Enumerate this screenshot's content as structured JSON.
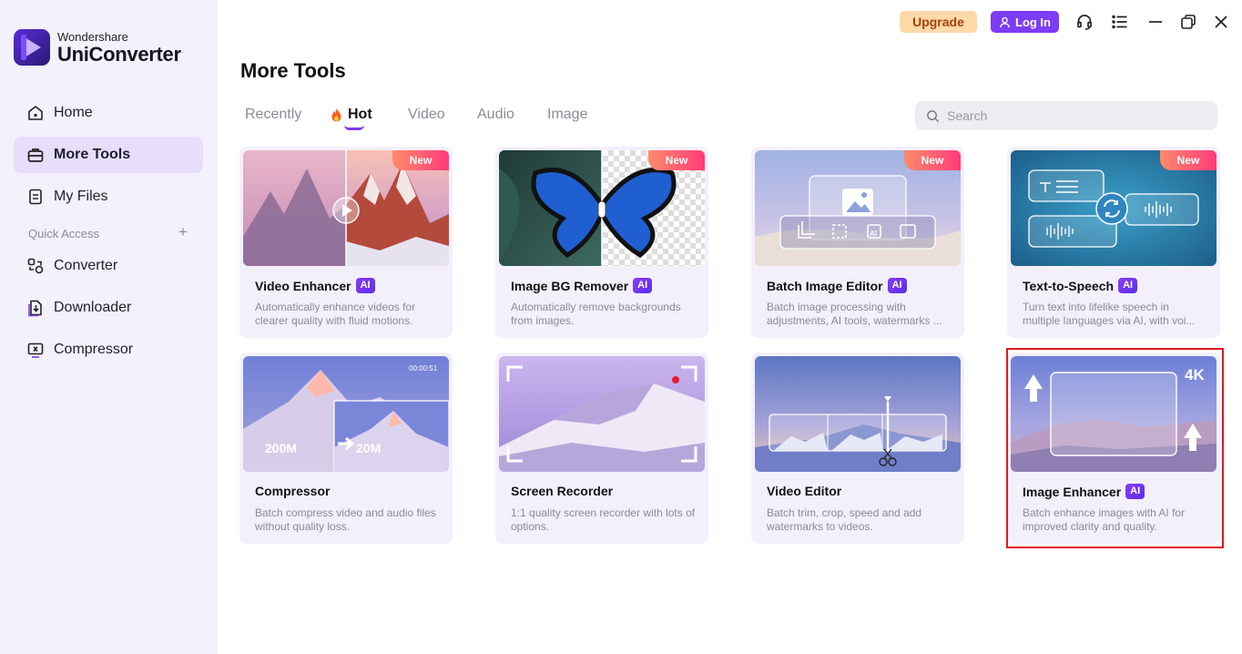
{
  "brand": {
    "sub": "Wondershare",
    "name": "UniConverter"
  },
  "sidebar": {
    "items": [
      {
        "label": "Home",
        "icon": "home-icon"
      },
      {
        "label": "More Tools",
        "icon": "toolbox-icon",
        "active": true
      },
      {
        "label": "My Files",
        "icon": "file-icon"
      }
    ],
    "quick_access_label": "Quick Access",
    "quick_access_add": "+",
    "quick_items": [
      {
        "label": "Converter",
        "icon": "converter-icon"
      },
      {
        "label": "Downloader",
        "icon": "downloader-icon"
      },
      {
        "label": "Compressor",
        "icon": "compressor-icon"
      }
    ]
  },
  "topbar": {
    "upgrade": "Upgrade",
    "login": "Log In"
  },
  "page": {
    "title": "More Tools"
  },
  "tabs": [
    "Recently",
    "Hot",
    "Video",
    "Audio",
    "Image"
  ],
  "active_tab": "Hot",
  "search": {
    "placeholder": "Search"
  },
  "tools": [
    {
      "title": "Video Enhancer",
      "ai": "AI",
      "badge": "New",
      "desc": "Automatically enhance videos for clearer quality with fluid motions."
    },
    {
      "title": "Image BG Remover",
      "ai": "AI",
      "badge": "New",
      "desc": "Automatically remove backgrounds from images."
    },
    {
      "title": "Batch Image Editor",
      "ai": "AI",
      "badge": "New",
      "desc": "Batch image processing with adjustments, AI tools, watermarks ..."
    },
    {
      "title": "Text-to-Speech",
      "ai": "AI",
      "badge": "New",
      "desc": "Turn text into lifelike speech in multiple languages via AI, with voi..."
    },
    {
      "title": "Compressor",
      "desc": "Batch compress video and audio files without quality loss.",
      "thumb_text": {
        "time": "00:00:51",
        "from": "200M",
        "to": "20M"
      }
    },
    {
      "title": "Screen Recorder",
      "desc": "1:1 quality screen recorder with lots of options."
    },
    {
      "title": "Video Editor",
      "desc": "Batch trim, crop, speed and add watermarks to videos."
    },
    {
      "title": "Image Enhancer",
      "ai": "AI",
      "desc": "Batch enhance images with AI for improved clarity and quality.",
      "thumb_text": {
        "res": "4K"
      }
    }
  ],
  "colors": {
    "accent": "#7d3cf5",
    "sidebar_bg": "#f3f1fb",
    "card_bg": "#f3f0fc",
    "highlight": "#e2161d",
    "upgrade_bg": "#ffd9a8"
  }
}
